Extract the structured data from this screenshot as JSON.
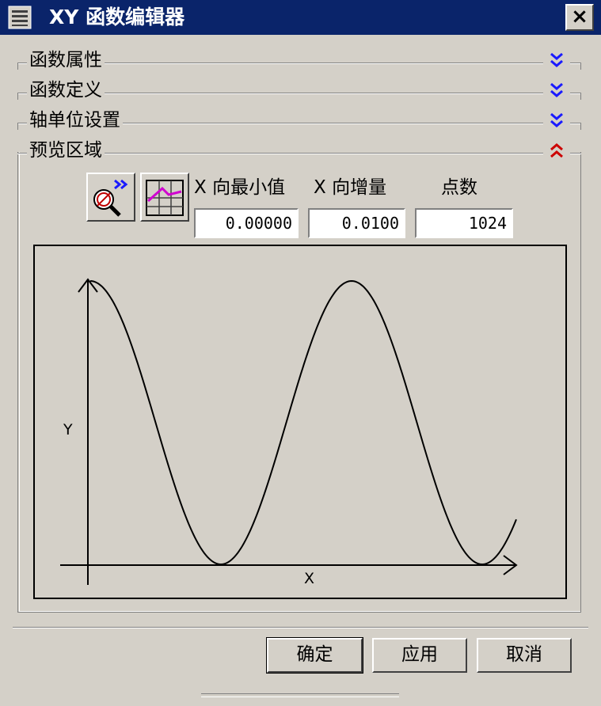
{
  "window": {
    "title": "XY 函数编辑器",
    "close_label": "×"
  },
  "sections": [
    {
      "label": "函数属性",
      "state": "collapsed"
    },
    {
      "label": "函数定义",
      "state": "collapsed"
    },
    {
      "label": "轴单位设置",
      "state": "collapsed"
    },
    {
      "label": "预览区域",
      "state": "expanded"
    }
  ],
  "preview": {
    "x_min_label": "X 向最小值",
    "x_step_label": "X 向增量",
    "points_label": "点数",
    "x_min_value": "0.00000",
    "x_step_value": "0.0100",
    "points_value": "1024",
    "graph": {
      "y_axis_label": "Y",
      "x_axis_label": "X"
    }
  },
  "buttons": {
    "ok": "确定",
    "apply": "应用",
    "cancel": "取消"
  },
  "colors": {
    "titlebar": "#0a246a",
    "collapse_chevron": "#1a1aff",
    "expand_chevron": "#cc0000",
    "plot_icon_line": "#d000d0"
  },
  "icons": {
    "system_menu": "window-menu-icon",
    "section_collapsed": "double-chevron-down-icon",
    "section_expanded": "double-chevron-up-icon",
    "zoom_fit": "magnifier-fit-icon",
    "plot_grid": "plot-grid-icon"
  }
}
